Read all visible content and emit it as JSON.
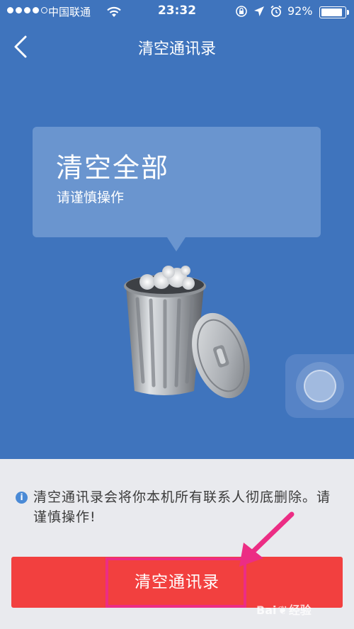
{
  "status_bar": {
    "carrier": "中国联通",
    "time": "23:32",
    "battery_percent": "92%",
    "battery_level": 0.92,
    "signal_bars_filled": 4,
    "signal_bars_total": 5
  },
  "nav": {
    "title": "清空通讯录",
    "back_icon": "chevron-left-icon"
  },
  "bubble": {
    "headline": "清空全部",
    "subtitle": "请谨慎操作"
  },
  "illustration": {
    "icon": "trash-can-icon"
  },
  "floating_ball": {
    "icon": "assistive-touch-icon"
  },
  "info": {
    "icon": "info-icon",
    "text": "清空通讯录会将你本机所有联系人彻底删除。请谨慎操作!"
  },
  "action": {
    "label": "清空通讯录"
  },
  "watermark": {
    "brand_left": "Bai",
    "brand_right": "经验"
  },
  "colors": {
    "header_blue": "#3f74bd",
    "button_red": "#f2403f",
    "highlight_pink": "#ec2d84",
    "background": "#e9eaee"
  }
}
